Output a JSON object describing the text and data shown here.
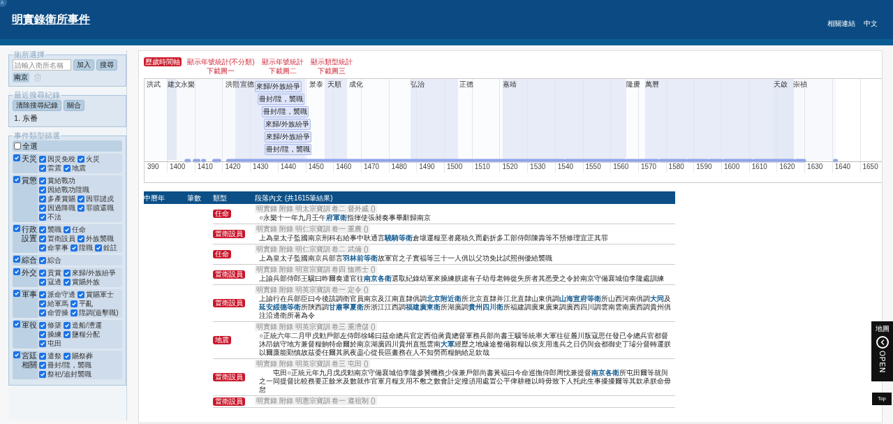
{
  "header": {
    "corner_badge": "A",
    "title": "明實錄衛所事件",
    "links": [
      "相關連結",
      "中文"
    ]
  },
  "sidebar": {
    "unit_select": {
      "legend": "衛所選擇",
      "placeholder": "請輸入衛所名稱",
      "buttons": [
        "加入",
        "搜尋"
      ],
      "chips": [
        "南京"
      ]
    },
    "history": {
      "legend": "最近搜尋紀錄",
      "buttons": [
        "清除搜尋紀錄",
        "關合"
      ],
      "items": [
        "1. 东番"
      ]
    },
    "filter": {
      "legend": "事件類型篩選",
      "select_all": {
        "label": "全選",
        "checked": false
      },
      "groups": [
        {
          "label": "天災",
          "checked": true,
          "items": [
            {
              "label": "因災免稅",
              "checked": true
            },
            {
              "label": "火災",
              "checked": true
            },
            {
              "label": "雷震",
              "checked": true
            },
            {
              "label": "地震",
              "checked": true
            }
          ]
        },
        {
          "label": "賞懲",
          "checked": true,
          "items": [
            {
              "label": "賞給戰功",
              "checked": true
            },
            {
              "label": "因給戰功陞職",
              "checked": true
            },
            {
              "label": "多產賞賜",
              "checked": true
            },
            {
              "label": "因罪譴戍",
              "checked": true
            },
            {
              "label": "因過降職",
              "checked": true
            },
            {
              "label": "罪贖還職",
              "checked": true
            },
            {
              "label": "不法",
              "checked": true
            }
          ]
        },
        {
          "label": "行政設置",
          "checked": true,
          "items": [
            {
              "label": "襲職",
              "checked": true
            },
            {
              "label": "任命",
              "checked": true
            },
            {
              "label": "置衛設員",
              "checked": true
            },
            {
              "label": "外族襲職",
              "checked": true
            },
            {
              "label": "命掌事",
              "checked": true
            },
            {
              "label": "陞職",
              "checked": true
            },
            {
              "label": "銓註",
              "checked": true
            }
          ]
        },
        {
          "label": "綜合",
          "checked": true,
          "items": [
            {
              "label": "綜合",
              "checked": true
            }
          ]
        },
        {
          "label": "外交",
          "checked": true,
          "items": [
            {
              "label": "貢賞",
              "checked": true
            },
            {
              "label": "來歸/外族紛爭",
              "checked": true
            },
            {
              "label": "寇邊",
              "checked": true
            },
            {
              "label": "賞賜外族",
              "checked": true
            }
          ]
        },
        {
          "label": "軍事",
          "checked": true,
          "items": [
            {
              "label": "派命守邊",
              "checked": true
            },
            {
              "label": "賞賜軍士",
              "checked": true
            },
            {
              "label": "給軍馬",
              "checked": true
            },
            {
              "label": "平亂",
              "checked": true
            },
            {
              "label": "命管操",
              "checked": true
            },
            {
              "label": "陞調(遊擊職)",
              "checked": true
            }
          ]
        },
        {
          "label": "軍役",
          "checked": true,
          "items": [
            {
              "label": "修築",
              "checked": true
            },
            {
              "label": "造船/漕運",
              "checked": true
            },
            {
              "label": "操練",
              "checked": true
            },
            {
              "label": "鹽糧分配",
              "checked": true
            },
            {
              "label": "屯田",
              "checked": true
            }
          ]
        },
        {
          "label": "宮廷相關",
          "checked": true,
          "items": [
            {
              "label": "遣祭",
              "checked": true
            },
            {
              "label": "賜祭葬",
              "checked": true
            },
            {
              "label": "冊封/陞，襲職",
              "checked": true
            },
            {
              "label": "祭祀/追封襲職",
              "checked": true
            }
          ]
        }
      ]
    }
  },
  "view_tabs": [
    {
      "label": "歷歲時間軸",
      "selected": true
    },
    {
      "label": "顯示年號統計(不分類)",
      "selected": false,
      "download": "下載圖一"
    },
    {
      "label": "顯示年號統計",
      "selected": false,
      "download": "下載圖二"
    },
    {
      "label": "顯示類型統計",
      "selected": false,
      "download": "下載圖三"
    }
  ],
  "timeline": {
    "eras": [
      "洪武",
      "建文",
      "永樂",
      "洪熙",
      "宣德",
      "景泰",
      "天順",
      "成化",
      "弘治",
      "正德",
      "嘉靖",
      "隆慶",
      "萬曆",
      "天啟",
      "崇禎"
    ],
    "events": [
      "來歸/外族紛爭",
      "冊封/陞，襲職",
      "冊封/陞，襲職",
      "來歸/外族紛爭",
      "來歸/外族紛爭",
      "冊封/陞，襲職"
    ],
    "ticks": [
      "390",
      "1400",
      "1410",
      "1420",
      "1430",
      "1440",
      "1450",
      "1460",
      "1470",
      "1480",
      "1490",
      "1500",
      "1510",
      "1520",
      "1530",
      "1540",
      "1550",
      "1560",
      "1570",
      "1580",
      "1590",
      "1600",
      "1610",
      "1620",
      "1630",
      "1640",
      "1650"
    ]
  },
  "table": {
    "columns": [
      "中曆年",
      "筆數",
      "類型",
      "段落內文 (共1615筆結果)"
    ],
    "rows": [
      {
        "type": "任命",
        "source": "明實錄 附錄 明太宗寶訓 卷二 督外戚 ()",
        "text": "○永樂十一年九月壬午**府軍衛**指揮使張昶奏事畢辭歸南京"
      },
      {
        "type": "置衛設員",
        "source": "明實錄 附錄 明仁宗寶訓 卷一 重農 ()",
        "text": "上為皇太子監國南京刑科右給事中耿通言**驍騎等衛**倉壞運糧至者露積久而虧折多工部侍郎陳壽等不預修理宜正其罪"
      },
      {
        "type": "任命",
        "source": "明實錄 附錄 明仁宗寶訓 卷二 武備 ()",
        "text": "上為皇太子監國南京兵部言**羽林前等衛**故軍官之子實福等三十一人俱以父功免比試照例優給襲職"
      },
      {
        "type": "置衛設員",
        "source": "明實錄 附錄 明宣宗寶訓 卷四 恤將士 ()",
        "text": "上諭兵部侍郎王驥曰昨爾奏遣官往**南京各衛**選取紀錄幼軍來操練朕慮有子幼母老轉徙失所者其悉受之令於南京守備襄城伯李隆處訓練"
      },
      {
        "type": "置衛設員",
        "source": "明實錄 附錄 明英宗寶訓 卷一 定令 ()",
        "text": "上諭行在兵部臣曰今後該調衛官員南京及江南直隸俱調**北京附近衛**所北京直隸并江北直隸山東俱調**山海宣府等衛**所山西河南俱調**大同**及**延安綏德等衛**所陝西調**甘肅寧夏衛**所浙江江西調**福建廣東衛**所湖廣調**貴州四川衛**所福建調廣東廣東調廣西四川調雲南雲南廣西調貴州俱注沿邊衛所著為令"
      },
      {
        "type": "地震",
        "source": "明實錄 附錄 明英宗寶訓 卷三 重漕儲 ()",
        "text": "○正統六年二月甲戌勅戶部左侍郎徐晞曰茲命總兵官定西伯蔣貴總督軍務兵部尚書王驥等統率大軍往征麓川叛寇思任發已令總兵官都督沐昂鎮守地方兼督糧餉特命爾於南京湖廣四川貴州直抵雲南**大軍**經歷之地緣途整備芻糧以俟支用進兵之日仍與僉都御史丁璿分督轉運朕以爾廉能勤慎故茲委任爾其夙夜盡心從長區畫務在人不知勞而糧餉給足欽哉"
      },
      {
        "type": "置衛設員",
        "source": "明實錄 附錄 明英宗寶訓 卷三 屯田 ()",
        "text": "屯田○正統元年九月戊戌勅南京守備襄城伯李隆參贊機務少保兼戶部尚書黃福曰今命巡撫侍郎周忱兼提督**南京各衛**所屯田爾等就與之一同提督比較務要正餘米及數就作官軍月糧支用不敷之數會計定撥須用處置公平俾耕種以時毋致下人托此生事擾擾爾等其欽承朕命毋怠"
      },
      {
        "type": "置衛設員",
        "source": "明實錄 附錄 明憲宗寶訓 卷一 遵祖制 ()"
      }
    ]
  },
  "side_tab": {
    "label": "地圖",
    "action": "OPEN"
  },
  "top_button": "Top"
}
